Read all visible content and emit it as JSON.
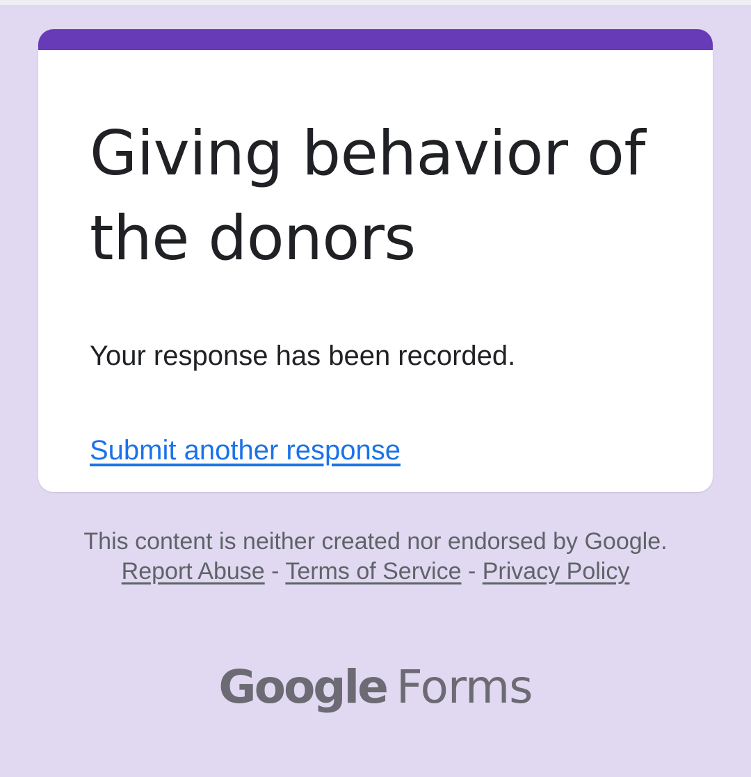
{
  "form": {
    "title": "Giving behavior of the donors",
    "confirmation": "Your response has been recorded.",
    "submit_another_label": "Submit another response"
  },
  "footer": {
    "disclaimer_text": "This content is neither created nor endorsed by Google.",
    "report_abuse_label": "Report Abuse",
    "separator": "-",
    "terms_label": "Terms of Service",
    "privacy_label": "Privacy Policy"
  },
  "brand": {
    "google": "Google",
    "forms": "Forms"
  },
  "colors": {
    "background": "#e0d9f1",
    "accent": "#673ab7",
    "link": "#1a73e8"
  }
}
